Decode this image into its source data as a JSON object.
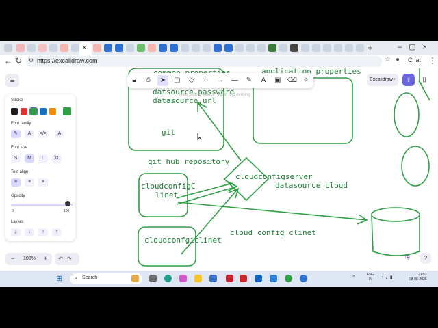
{
  "browser": {
    "url": "https://excalidraw.com",
    "tab_close_glyph": "×",
    "new_tab_glyph": "+",
    "chat_label": "Chat"
  },
  "toolbar": {
    "tools": [
      "lock-icon",
      "hand-icon",
      "selection-icon",
      "rectangle-icon",
      "diamond-icon",
      "ellipse-icon",
      "arrow-icon",
      "line-icon",
      "pencil-icon",
      "text-icon",
      "image-icon",
      "eraser-icon",
      "laser-icon"
    ],
    "active_tool": "selection-icon",
    "hint": "Hold Shift to select + Alt to find existing"
  },
  "header": {
    "excalidraw_plus": "Excalidraw+"
  },
  "panel": {
    "stroke_label": "Stroke",
    "stroke_colors": [
      "#1e1e1e",
      "#e03131",
      "#2f9e44",
      "#1971c2",
      "#f08c00"
    ],
    "current_stroke": "#2f9e44",
    "font_family_label": "Font family",
    "font_size_label": "Font size",
    "font_sizes": [
      "S",
      "M",
      "L",
      "XL"
    ],
    "selected_font_size": "M",
    "text_align_label": "Text align",
    "opacity_label": "Opacity",
    "opacity_min": "0",
    "opacity_max": "100",
    "opacity_value": 100,
    "layers_label": "Layers"
  },
  "canvas_text": {
    "common_properties": "common properties",
    "application_properties": "application properties",
    "datasource_password": "datsource.password",
    "datasource_url": "datasource.url",
    "git": "git",
    "git_hub_repository": "git hub repository",
    "cloudconfigserver": "cloudconfigserver",
    "datasource_cloud": "datasource cloud",
    "cloudconfigclinet_1a": "cloudconfigC",
    "cloudconfigclinet_1b": "linet",
    "cloudconfigclinet_2": "cloudconfgiclinet",
    "cloud_config_clinet": "cloud config clinet"
  },
  "zoom": {
    "minus": "−",
    "value": "108%",
    "plus": "+"
  },
  "taskbar": {
    "search_label": "Search",
    "lang_1": "ENG",
    "lang_2": "IN",
    "time": "21:53",
    "date": "08-08-2026"
  },
  "colors": {
    "ink": "#1e7e34",
    "accent": "#6965db"
  }
}
